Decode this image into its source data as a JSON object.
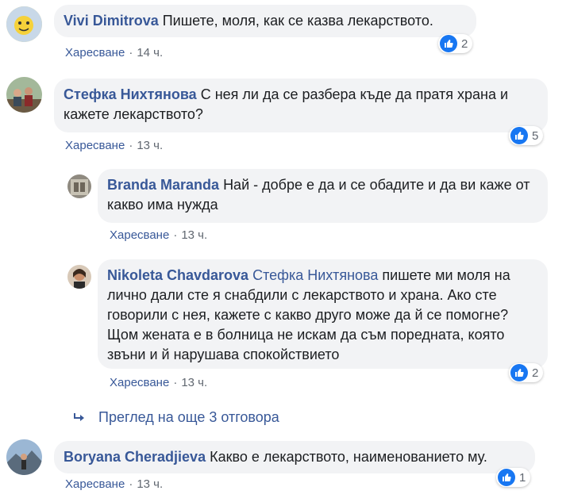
{
  "colors": {
    "link": "#385898",
    "bubble": "#f2f3f5",
    "meta": "#606770",
    "like_blue": "#1877f2"
  },
  "comments": [
    {
      "author": "Vivi Dimitrova",
      "text": "Пишете, моля, как се казва лекарството.",
      "like_label": "Харесване",
      "time": "14 ч.",
      "reactions": "2",
      "reaction_icon": "thumbs-up-icon"
    },
    {
      "author": "Стефка Нихтянова",
      "text": "С нея ли да се разбера къде да пратя храна и кажете лекарството?",
      "like_label": "Харесване",
      "time": "13 ч.",
      "reactions": "5",
      "reaction_icon": "thumbs-up-icon"
    }
  ],
  "replies": [
    {
      "author": "Branda Maranda",
      "text": "Най - добре е да и се обадите и да ви каже от какво има нужда",
      "like_label": "Харесване",
      "time": "13 ч."
    },
    {
      "author": "Nikoleta Chavdarova",
      "mention": "Стефка Нихтянова",
      "text": "пишете ми моля на лично дали сте я снабдили с лекарството и храна. Ако сте говорили с нея, кажете с какво друго може да й се помогне? Щом жената е в болница не искам да съм поредната, която звъни и й нарушава спокойствието",
      "like_label": "Харесване",
      "time": "13 ч.",
      "reactions": "2",
      "reaction_icon": "thumbs-up-icon"
    }
  ],
  "more_replies_label": "Преглед на още 3 отговора",
  "last_comment": {
    "author": "Boryana Cheradjieva",
    "text": "Какво е лекарството, наименованието му.",
    "like_label": "Харесване",
    "time": "13 ч.",
    "reactions": "1",
    "reaction_icon": "thumbs-up-icon"
  }
}
